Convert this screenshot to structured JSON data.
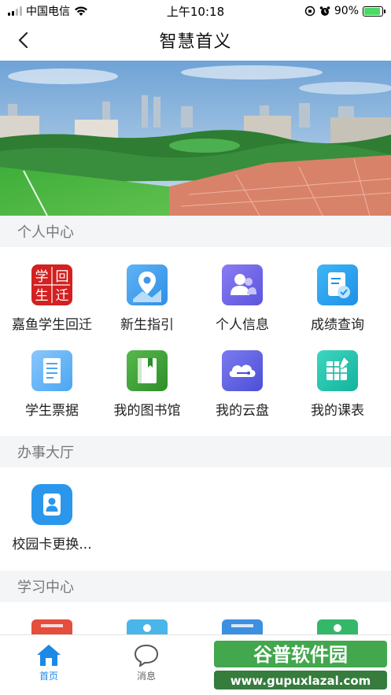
{
  "status_bar": {
    "carrier": "中国电信",
    "time": "上午10:18",
    "battery": "90%"
  },
  "nav": {
    "title": "智慧首义"
  },
  "sections": {
    "personal": {
      "title": "个人中心",
      "items": [
        {
          "label": "嘉鱼学生回迁",
          "icon": "seal-icon",
          "seal_text": [
            "学",
            "回",
            "生",
            "迁"
          ]
        },
        {
          "label": "新生指引",
          "icon": "map-pin-icon"
        },
        {
          "label": "个人信息",
          "icon": "user-info-icon"
        },
        {
          "label": "成绩查询",
          "icon": "grade-check-icon"
        },
        {
          "label": "学生票据",
          "icon": "receipt-icon"
        },
        {
          "label": "我的图书馆",
          "icon": "book-icon"
        },
        {
          "label": "我的云盘",
          "icon": "cloud-disk-icon"
        },
        {
          "label": "我的课表",
          "icon": "schedule-icon"
        }
      ]
    },
    "office": {
      "title": "办事大厅",
      "items": [
        {
          "label": "校园卡更换...",
          "icon": "campus-card-icon"
        }
      ]
    },
    "study": {
      "title": "学习中心"
    }
  },
  "tabs": [
    {
      "label": "首页",
      "icon": "home-icon",
      "active": true
    },
    {
      "label": "消息",
      "icon": "message-icon",
      "active": false
    }
  ],
  "watermark": {
    "title": "谷普软件园",
    "url": "www.gupuxlazal.com"
  },
  "colors": {
    "accent": "#1e88e5",
    "section_bg": "#f4f5f7"
  }
}
